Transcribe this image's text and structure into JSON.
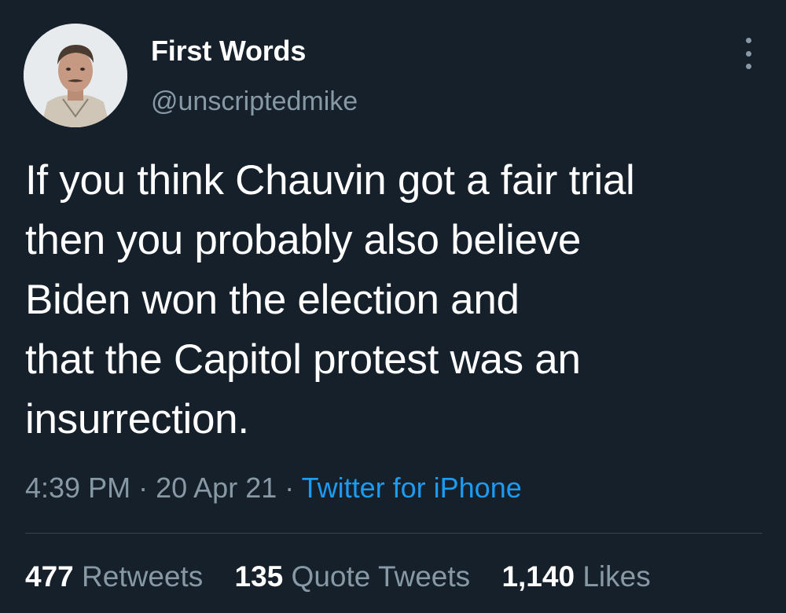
{
  "author": {
    "display_name": "First Words",
    "handle": "@unscriptedmike"
  },
  "tweet": {
    "lines": [
      "If you think Chauvin got a fair trial",
      "then you probably also believe",
      "Biden won the election and",
      "that the Capitol protest was an",
      "insurrection."
    ],
    "time": "4:39 PM",
    "date": "20 Apr 21",
    "separator": "·",
    "source": "Twitter for iPhone"
  },
  "stats": {
    "retweets_count": "477",
    "retweets_label": "Retweets",
    "quote_count": "135",
    "quote_label": "Quote Tweets",
    "likes_count": "1,140",
    "likes_label": "Likes"
  },
  "colors": {
    "background": "#15202b",
    "text_primary": "#ffffff",
    "text_secondary": "#8899a6",
    "accent": "#1d9bf0",
    "divider": "#38444d"
  },
  "icons": {
    "more_menu": "more-vertical-icon"
  }
}
